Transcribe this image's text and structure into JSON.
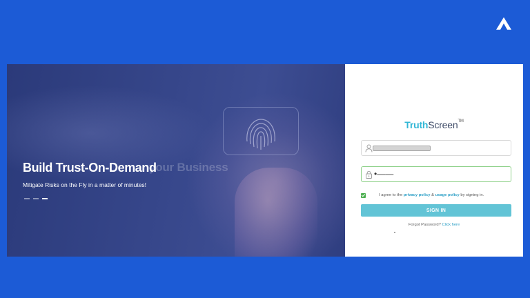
{
  "hero": {
    "ghost_text": "r your Business",
    "title": "Build Trust-On-Demand",
    "subtitle": "Mitigate Risks on the Fly in a matter of minutes!",
    "slides": 3,
    "active_slide": 3
  },
  "brand": {
    "part1": "Truth",
    "part2": "Screen",
    "tm": "TM"
  },
  "login": {
    "username_value": "",
    "password_value": "•——",
    "agree_prefix": "I agree to the ",
    "privacy_label": "privacy policy",
    "amp": " & ",
    "usage_label": "usage policy",
    "agree_suffix": " by signing in.",
    "signin_label": "SIGN IN",
    "forgot_prefix": "Forgot Password? ",
    "forgot_link": "Click here"
  },
  "colors": {
    "background": "#1c5bd6",
    "brand_accent": "#33b7d6",
    "button": "#62c4d6",
    "checkbox": "#4caf50"
  },
  "icons": [
    "app-logo-icon",
    "fingerprint-icon",
    "user-icon",
    "lock-icon",
    "checkmark-icon"
  ]
}
